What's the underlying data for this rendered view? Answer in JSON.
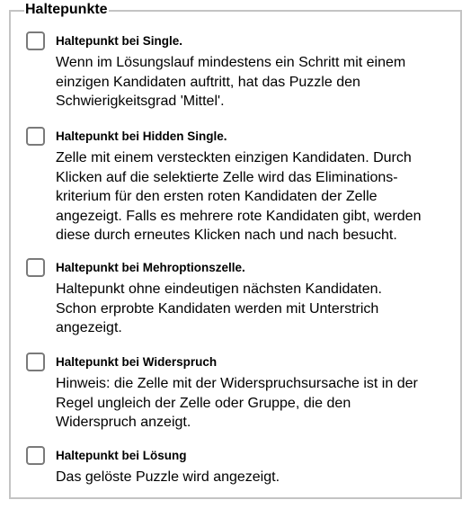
{
  "group": {
    "legend": "Haltepunkte"
  },
  "options": [
    {
      "title": "Haltepunkt bei Single.",
      "description": "Wenn im Lösungslauf mindestens ein Schritt mit einem\neinzigen Kandidaten auftritt, hat das Puzzle den\nSchwierigkeitsgrad 'Mittel'.",
      "checked": false
    },
    {
      "title": "Haltepunkt bei Hidden Single.",
      "description": "Zelle mit einem versteckten einzigen Kandidaten. Durch\nKlicken auf die selektierte Zelle wird das Eliminations-\nkriterium für den ersten roten Kandidaten der Zelle\nangezeigt. Falls es mehrere rote Kandidaten gibt, werden\ndiese durch erneutes Klicken nach und nach besucht.",
      "checked": false
    },
    {
      "title": "Haltepunkt bei Mehroptionszelle.",
      "description": "Haltepunkt ohne eindeutigen nächsten Kandidaten.\nSchon erprobte Kandidaten werden mit Unterstrich\nangezeigt.",
      "checked": false
    },
    {
      "title": "Haltepunkt bei Widerspruch",
      "description": "Hinweis: die Zelle mit der Widerspruchsursache ist in der\nRegel ungleich der Zelle oder Gruppe, die den\nWiderspruch anzeigt.",
      "checked": false
    },
    {
      "title": "Haltepunkt bei Lösung",
      "description": "Das gelöste Puzzle wird angezeigt.",
      "checked": false
    }
  ]
}
